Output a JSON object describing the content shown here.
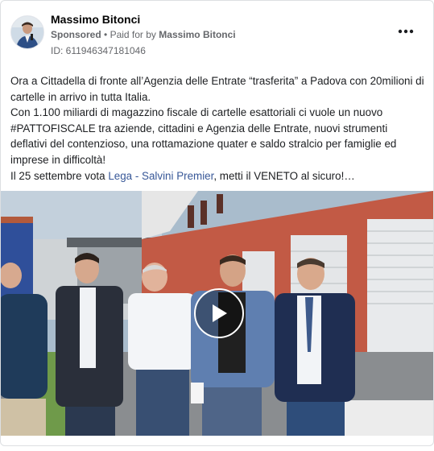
{
  "post": {
    "page_name": "Massimo Bitonci",
    "sponsored_label": "Sponsored",
    "separator": "•",
    "paid_for_prefix": "Paid for by",
    "paid_for_name": "Massimo Bitonci",
    "ad_id": "ID: 611946347181046",
    "more_icon": "more-horizontal-icon",
    "text": {
      "line1": "Ora a Cittadella di fronte all’Agenzia delle Entrate “trasferita” a Padova con 20milioni di cartelle in arrivo in tutta Italia.",
      "line2": "Con 1.100 miliardi di magazzino fiscale di cartelle esattoriali ci vuole un nuovo #PATTOFISCALE tra aziende, cittadini e Agenzia delle Entrate, nuovi strumenti deflativi del contenzioso, una rottamazione quater e saldo stralcio per famiglie ed imprese in difficoltà!",
      "line3_before": "Il 25 settembre vota ",
      "link1": "Lega",
      "link_sep": " - ",
      "link2": "Salvini Premier",
      "line3_after": ", metti il VENETO al sicuro!…"
    },
    "media": {
      "type": "video",
      "play_icon": "play-icon"
    }
  }
}
